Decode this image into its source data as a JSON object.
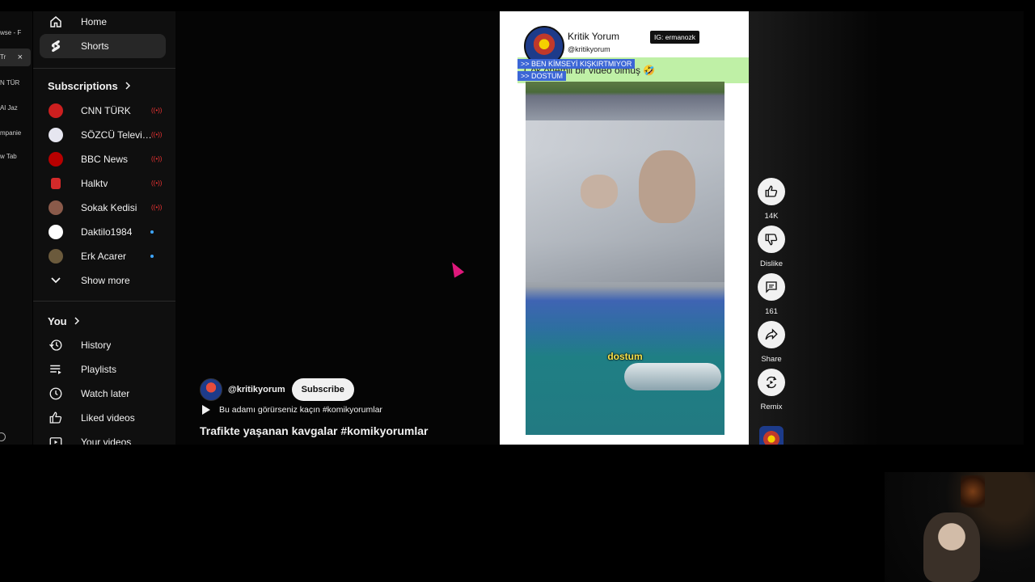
{
  "tabstrip": {
    "tabs": [
      {
        "label": "wse - F"
      },
      {
        "label": "Tr",
        "active": true
      },
      {
        "label": "N TÜR"
      },
      {
        "label": "Al Jaz"
      },
      {
        "label": "mpanie"
      },
      {
        "label": "w Tab"
      }
    ],
    "close_glyph": "×"
  },
  "sidebar": {
    "home_label": "Home",
    "shorts_label": "Shorts",
    "subscriptions_title": "Subscriptions",
    "subscriptions": [
      {
        "name": "CNN TÜRK",
        "status": "live",
        "avatar_color": "#cc1f1f"
      },
      {
        "name": "SÖZCÜ Televizyo...",
        "status": "live",
        "avatar_color": "#e6e6f0"
      },
      {
        "name": "BBC News",
        "status": "live",
        "avatar_color": "#b80000"
      },
      {
        "name": "Halktv",
        "status": "live",
        "avatar_color": "#d42a2a"
      },
      {
        "name": "Sokak Kedisi",
        "status": "live",
        "avatar_color": "#8a5a4a"
      },
      {
        "name": "Daktilo1984",
        "status": "new",
        "avatar_color": "#ffffff"
      },
      {
        "name": "Erk Acarer",
        "status": "new",
        "avatar_color": "#6b5a3c"
      }
    ],
    "show_more_label": "Show more",
    "you_title": "You",
    "you_items": [
      {
        "label": "History",
        "icon": "history-icon"
      },
      {
        "label": "Playlists",
        "icon": "playlists-icon"
      },
      {
        "label": "Watch later",
        "icon": "clock-icon"
      },
      {
        "label": "Liked videos",
        "icon": "thumbs-up-icon"
      },
      {
        "label": "Your videos",
        "icon": "video-icon"
      }
    ]
  },
  "short": {
    "channel_handle": "@kritikyorum",
    "subscribe_label": "Subscribe",
    "description": "Bu adamı görürseniz kaçın #komikyorumlar",
    "title": "Trafikte yaşanan kavgalar #komikyorumlar"
  },
  "player": {
    "creator_name": "Kritik Yorum",
    "creator_handle": "@kritikyorum",
    "ig_badge": "IG: ermanozk",
    "overlay_line1": ">> BEN KİMSEYİ KIŞKIRTMIYOR",
    "overlay_line2": ">> DOSTUM",
    "banner_caption": "Çok önemli bir video olmuş 🤣",
    "subtitle": "dostum"
  },
  "actions": {
    "like_count": "14K",
    "dislike_label": "Dislike",
    "comment_count": "161",
    "share_label": "Share",
    "remix_label": "Remix"
  },
  "colors": {
    "background": "#0f0f0f",
    "accent_live": "#e33333",
    "accent_new": "#3ea6ff",
    "cursor": "#e0187c"
  }
}
